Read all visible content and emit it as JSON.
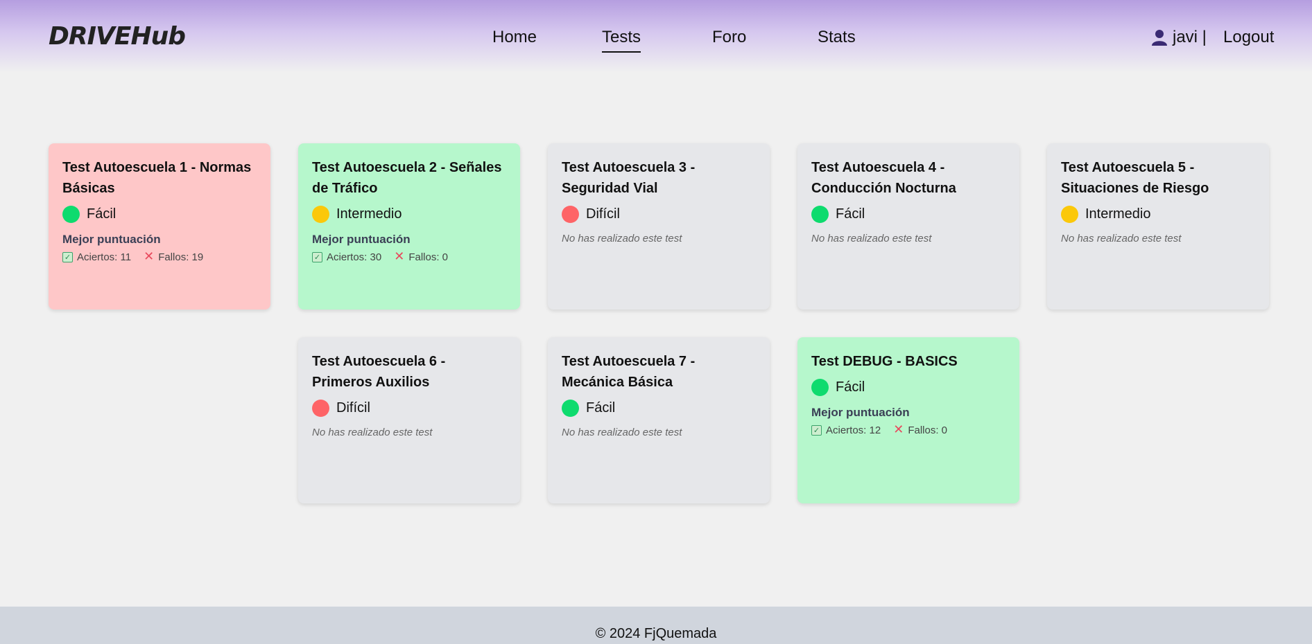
{
  "brand": {
    "logo_caps": "Drive",
    "logo_rest": "Hub"
  },
  "nav": {
    "items": [
      {
        "label": "Home"
      },
      {
        "label": "Tests"
      },
      {
        "label": "Foro"
      },
      {
        "label": "Stats"
      }
    ],
    "active": "Tests"
  },
  "user": {
    "name": "javi |",
    "logout_label": "Logout"
  },
  "colors": {
    "card_failed": "#fec7c8",
    "card_passed": "#b6f7cc",
    "card_untested": "#e6e7ea",
    "easy": "#0edb6e",
    "intermediate": "#fbc80a",
    "hard": "#fe6467"
  },
  "labels": {
    "best_score": "Mejor puntuación",
    "not_done": "No has realizado este test"
  },
  "tests": [
    {
      "title": "Test Autoescuela 1 - Normas Básicas",
      "difficulty": "Fácil",
      "best_label": "Mejor puntuación",
      "hits": "Aciertos: 11",
      "fails": "Fallos: 19"
    },
    {
      "title": "Test Autoescuela 2 - Señales de Tráfico",
      "difficulty": "Intermedio",
      "best_label": "Mejor puntuación",
      "hits": "Aciertos: 30",
      "fails": "Fallos: 0"
    },
    {
      "title": "Test Autoescuela 3 - Seguridad Vial",
      "difficulty": "Difícil",
      "status": "No has realizado este test"
    },
    {
      "title": "Test Autoescuela 4 - Conducción Nocturna",
      "difficulty": "Fácil",
      "status": "No has realizado este test"
    },
    {
      "title": "Test Autoescuela 5 - Situaciones de Riesgo",
      "difficulty": "Intermedio",
      "status": "No has realizado este test"
    },
    {
      "title": "Test Autoescuela 6 - Primeros Auxilios",
      "difficulty": "Difícil",
      "status": "No has realizado este test"
    },
    {
      "title": "Test Autoescuela 7 - Mecánica Básica",
      "difficulty": "Fácil",
      "status": "No has realizado este test"
    },
    {
      "title": "Test DEBUG - BASICS",
      "difficulty": "Fácil",
      "best_label": "Mejor puntuación",
      "hits": "Aciertos: 12",
      "fails": "Fallos: 0"
    }
  ],
  "footer": {
    "text": "© 2024 FjQuemada"
  }
}
